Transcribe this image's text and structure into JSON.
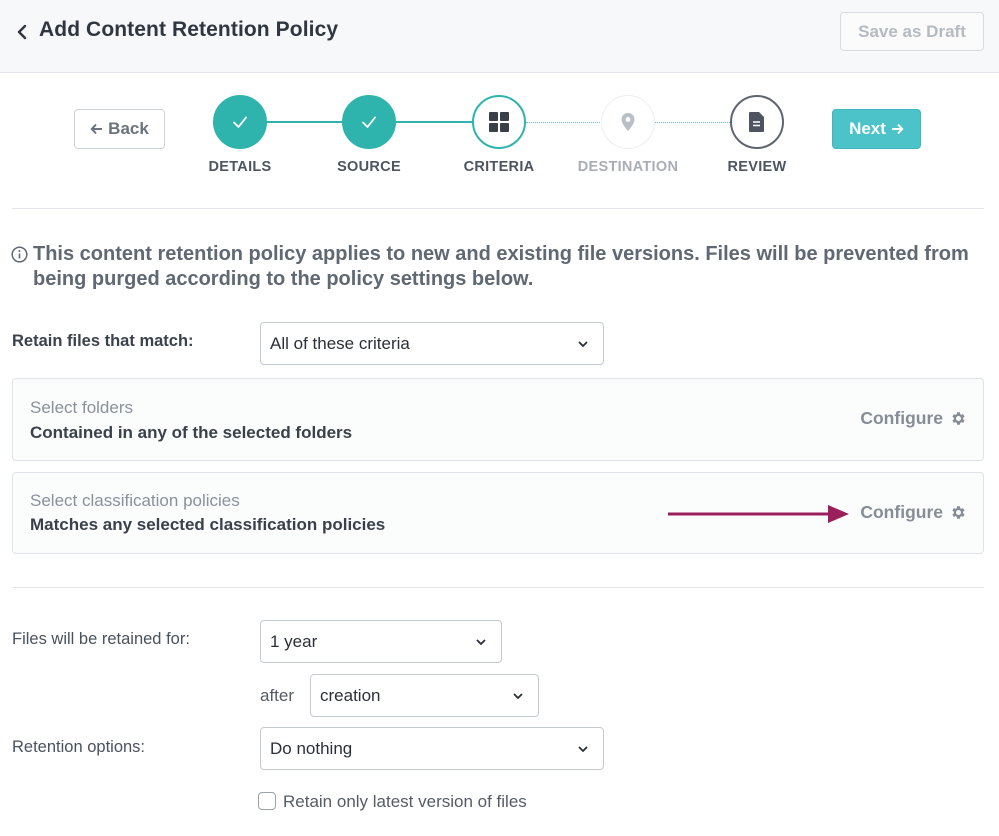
{
  "header": {
    "title": "Add Content Retention Policy",
    "save_draft_label": "Save as Draft"
  },
  "stepper": {
    "back_label": "Back",
    "next_label": "Next",
    "steps": [
      {
        "label": "DETAILS",
        "state": "done",
        "icon": "check-icon"
      },
      {
        "label": "SOURCE",
        "state": "done",
        "icon": "check-icon"
      },
      {
        "label": "CRITERIA",
        "state": "current",
        "icon": "grid-icon"
      },
      {
        "label": "DESTINATION",
        "state": "pending",
        "icon": "location-pin-icon"
      },
      {
        "label": "REVIEW",
        "state": "upcoming",
        "icon": "document-icon"
      }
    ]
  },
  "info": {
    "text": "This content retention policy applies to new and existing file versions. Files will be prevented from being purged according to the policy settings below."
  },
  "match": {
    "label": "Retain files that match:",
    "value": "All of these criteria"
  },
  "cards": [
    {
      "title": "Select folders",
      "subtitle": "Contained in any of the selected folders",
      "action": "Configure"
    },
    {
      "title": "Select classification policies",
      "subtitle": "Matches any selected classification policies",
      "action": "Configure"
    }
  ],
  "retention": {
    "retained_label": "Files will be retained for:",
    "duration_value": "1 year",
    "after_label": "after",
    "after_value": "creation",
    "options_label": "Retention options:",
    "options_value": "Do nothing",
    "checkbox_label": "Retain only latest version of files",
    "checkbox_checked": false
  },
  "colors": {
    "accent": "#2fb3ad",
    "next_button": "#4cc3c8",
    "annotation_arrow": "#9b1f5b"
  }
}
